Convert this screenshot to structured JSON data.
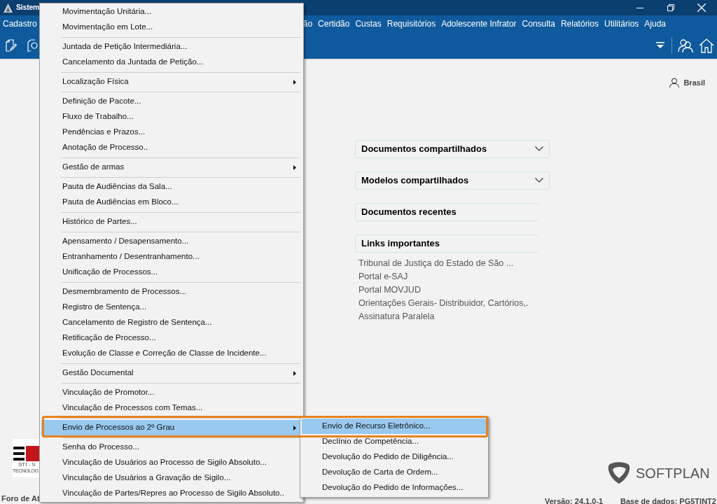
{
  "window": {
    "title": "Sistem"
  },
  "menu_bar": [
    {
      "label": "Cadastro"
    },
    {
      "label": "ão"
    },
    {
      "label": "Certidão"
    },
    {
      "label": "Custas"
    },
    {
      "label": "Requisitórios"
    },
    {
      "label": "Adolescente Infrator"
    },
    {
      "label": "Consulta"
    },
    {
      "label": "Relatórios"
    },
    {
      "label": "Utilitários"
    },
    {
      "label": "Ajuda"
    }
  ],
  "user": {
    "name": "Brasil"
  },
  "panels": [
    {
      "title": "Documentos compartilhados",
      "expandable": true
    },
    {
      "title": "Modelos compartilhados",
      "expandable": true
    },
    {
      "title": "Documentos recentes",
      "expandable": false
    },
    {
      "title": "Links importantes",
      "expandable": false
    }
  ],
  "links": [
    "Tribunal de Justiça do Estado de São ...",
    "Portal e-SAJ",
    "Portal MOVJUD",
    "Orientações Gerais- Distribuidor, Cartórios,.",
    "Assinatura Paralela"
  ],
  "logo": {
    "caption_1": "STI - S",
    "caption_2": "TECNOLOG"
  },
  "brand": "SOFTPLAN",
  "status_bar": {
    "location": "Foro de At",
    "version": "Versão: 24.1.0-1",
    "database": "Base de dados: PG5TINT2"
  },
  "dropdown_menu": {
    "items": [
      {
        "kind": "item",
        "label": "Movimentação Unitária...",
        "submenu": false,
        "selected": false
      },
      {
        "kind": "item",
        "label": "Movimentação em Lote...",
        "submenu": false,
        "selected": false
      },
      {
        "kind": "separator"
      },
      {
        "kind": "item",
        "label": "Juntada de Petição Intermediária...",
        "submenu": false,
        "selected": false
      },
      {
        "kind": "item",
        "label": "Cancelamento da Juntada de Petição...",
        "submenu": false,
        "selected": false
      },
      {
        "kind": "separator"
      },
      {
        "kind": "item",
        "label": "Localização Física",
        "submenu": true,
        "selected": false
      },
      {
        "kind": "separator"
      },
      {
        "kind": "item",
        "label": "Definição de Pacote...",
        "submenu": false,
        "selected": false
      },
      {
        "kind": "item",
        "label": "Fluxo de Trabalho...",
        "submenu": false,
        "selected": false
      },
      {
        "kind": "item",
        "label": "Pendências e Prazos...",
        "submenu": false,
        "selected": false
      },
      {
        "kind": "item",
        "label": "Anotação de Processo..",
        "submenu": false,
        "selected": false
      },
      {
        "kind": "separator"
      },
      {
        "kind": "item",
        "label": "Gestão de armas",
        "submenu": true,
        "selected": false
      },
      {
        "kind": "separator"
      },
      {
        "kind": "item",
        "label": "Pauta de Audiências da Sala...",
        "submenu": false,
        "selected": false
      },
      {
        "kind": "item",
        "label": "Pauta de Audiências em Bloco...",
        "submenu": false,
        "selected": false
      },
      {
        "kind": "separator"
      },
      {
        "kind": "item",
        "label": "Histórico de Partes...",
        "submenu": false,
        "selected": false
      },
      {
        "kind": "separator"
      },
      {
        "kind": "item",
        "label": "Apensamento / Desapensamento...",
        "submenu": false,
        "selected": false
      },
      {
        "kind": "item",
        "label": "Entranhamento / Desentranhamento...",
        "submenu": false,
        "selected": false
      },
      {
        "kind": "item",
        "label": "Unificação de Processos...",
        "submenu": false,
        "selected": false
      },
      {
        "kind": "separator"
      },
      {
        "kind": "item",
        "label": "Desmembramento de Processos...",
        "submenu": false,
        "selected": false
      },
      {
        "kind": "item",
        "label": "Registro de Sentença...",
        "submenu": false,
        "selected": false
      },
      {
        "kind": "item",
        "label": "Cancelamento de Registro de Sentença...",
        "submenu": false,
        "selected": false
      },
      {
        "kind": "item",
        "label": "Retificação de Processo...",
        "submenu": false,
        "selected": false
      },
      {
        "kind": "item",
        "label": "Evolução de Classe e Correção de Classe de Incidente...",
        "submenu": false,
        "selected": false
      },
      {
        "kind": "separator"
      },
      {
        "kind": "item",
        "label": "Gestão Documental",
        "submenu": true,
        "selected": false
      },
      {
        "kind": "separator"
      },
      {
        "kind": "item",
        "label": "Vinculação de Promotor...",
        "submenu": false,
        "selected": false
      },
      {
        "kind": "item",
        "label": "Vinculação de Processos com Temas...",
        "submenu": false,
        "selected": false
      },
      {
        "kind": "separator"
      },
      {
        "kind": "item",
        "label": "Envio de Processos ao 2º Grau",
        "submenu": true,
        "selected": true
      },
      {
        "kind": "separator"
      },
      {
        "kind": "item",
        "label": "Senha do Processo...",
        "submenu": false,
        "selected": false
      },
      {
        "kind": "item",
        "label": "Vinculação de Usuários ao Processo de Sigilo Absoluto...",
        "submenu": false,
        "selected": false
      },
      {
        "kind": "item",
        "label": "Vinculação de Usuários a Gravação de Sigilo...",
        "submenu": false,
        "selected": false
      },
      {
        "kind": "item",
        "label": "Vinculação de Partes/Repres ao Processo de Sigilo Absoluto..",
        "submenu": false,
        "selected": false
      }
    ]
  },
  "submenu": {
    "items": [
      {
        "label": "Envio de Recurso Eletrônico...",
        "selected": true
      },
      {
        "label": "Declínio de Competência...",
        "selected": false
      },
      {
        "label": "Devolução do Pedido de Diligência...",
        "selected": false
      },
      {
        "label": "Devolução de Carta de Ordem...",
        "selected": false
      },
      {
        "label": "Devolução do Pedido de Informações...",
        "selected": false
      }
    ]
  }
}
